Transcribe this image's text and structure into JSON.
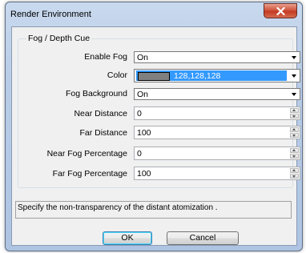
{
  "window": {
    "title": "Render Environment"
  },
  "group": {
    "title": "Fog / Depth Cue"
  },
  "fields": {
    "enable_fog": {
      "label": "Enable Fog",
      "value": "On"
    },
    "color": {
      "label": "Color",
      "value": "128,128,128",
      "swatch_hex": "#808080"
    },
    "fog_background": {
      "label": "Fog Background",
      "value": "On"
    },
    "near_distance": {
      "label": "Near Distance",
      "value": "0"
    },
    "far_distance": {
      "label": "Far Distance",
      "value": "100"
    },
    "near_fog_percentage": {
      "label": "Near Fog Percentage",
      "value": "0"
    },
    "far_fog_percentage": {
      "label": "Far Fog Percentage",
      "value": "100"
    }
  },
  "description": "Specify the non-transparency of the distant atomization .",
  "buttons": {
    "ok": "OK",
    "cancel": "Cancel"
  }
}
